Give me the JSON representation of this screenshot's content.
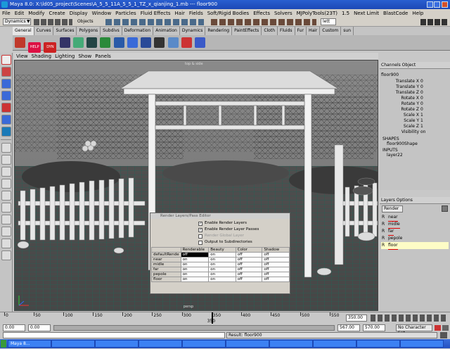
{
  "window": {
    "title": "Maya 8.0: X:\\ld05_project\\Scenes\\A_5_5_11A_5_5_1_TZ_x_qianjing_1.mb  ---  floor900"
  },
  "menubar": [
    "File",
    "Edit",
    "Modify",
    "Create",
    "Display",
    "Window",
    "Particles",
    "Fluid Effects",
    "Hair",
    "Fields",
    "Soft/Rigid Bodies",
    "Effects",
    "Solvers",
    "MJPolyTools(23T)",
    "1.5",
    "Next Limit",
    "BlastCode",
    "Help"
  ],
  "statusline": {
    "mode_dropdown": "Dynamics",
    "objects_label": "Objects",
    "field_value": "lett"
  },
  "shelf_tabs": [
    "General",
    "Curves",
    "Surfaces",
    "Polygons",
    "Subdivs",
    "Deformation",
    "Animation",
    "Dynamics",
    "Rendering",
    "PaintEffects",
    "Cloth",
    "Fluids",
    "Fur",
    "Hair",
    "Custom",
    "sun"
  ],
  "shelf": {
    "help_label": "HELP",
    "dyn_label": "DYN"
  },
  "panel_menu": [
    "View",
    "Shading",
    "Lighting",
    "Show",
    "Panels"
  ],
  "viewport": {
    "camera_label": "persp",
    "top_label": "top & side"
  },
  "render_layers_window": {
    "title": "Render Layers/Pass Editor",
    "checkboxes": [
      {
        "label": "Enable Render Layers",
        "checked": true
      },
      {
        "label": "Enable Render Layer Passes",
        "checked": true
      },
      {
        "label": "Render Global Layer",
        "checked": false
      },
      {
        "label": "Output to Subdirectories",
        "checked": false
      }
    ],
    "columns": [
      "",
      "Renderable",
      "Beauty",
      "Color",
      "Shadow"
    ],
    "rows": [
      {
        "name": "defaultRende",
        "renderable": "off",
        "beauty": "on",
        "color": "off",
        "shadow": "off"
      },
      {
        "name": "near",
        "renderable": "on",
        "beauty": "on",
        "color": "off",
        "shadow": "off"
      },
      {
        "name": "midle",
        "renderable": "on",
        "beauty": "on",
        "color": "off",
        "shadow": "off"
      },
      {
        "name": "far",
        "renderable": "on",
        "beauty": "on",
        "color": "off",
        "shadow": "off"
      },
      {
        "name": "pepole",
        "renderable": "on",
        "beauty": "on",
        "color": "off",
        "shadow": "off"
      },
      {
        "name": "floor",
        "renderable": "on",
        "beauty": "on",
        "color": "off",
        "shadow": "off"
      }
    ]
  },
  "channel_box": {
    "header": "Channels  Object",
    "object_name": "floor900",
    "attributes": [
      {
        "name": "Translate X",
        "value": "0"
      },
      {
        "name": "Translate Y",
        "value": "0"
      },
      {
        "name": "Translate Z",
        "value": "0"
      },
      {
        "name": "Rotate X",
        "value": "0"
      },
      {
        "name": "Rotate Y",
        "value": "0"
      },
      {
        "name": "Rotate Z",
        "value": "0"
      },
      {
        "name": "Scale X",
        "value": "1"
      },
      {
        "name": "Scale Y",
        "value": "1"
      },
      {
        "name": "Scale Z",
        "value": "1"
      },
      {
        "name": "Visibility",
        "value": "on"
      }
    ],
    "shapes_label": "SHAPES",
    "shape_name": "floor900Shape",
    "inputs_label": "INPUTS",
    "input_name": "layer22"
  },
  "layers_panel": {
    "header": "Layers  Options",
    "dropdown": "Render",
    "layers": [
      {
        "flag": "R",
        "name": "near",
        "selected": false
      },
      {
        "flag": "R",
        "name": "midle",
        "selected": false
      },
      {
        "flag": "R",
        "name": "far",
        "selected": false
      },
      {
        "flag": "R",
        "name": "pepole",
        "selected": false
      },
      {
        "flag": "R",
        "name": "floor",
        "selected": true
      }
    ]
  },
  "timeline": {
    "ticks": [
      "0",
      "50",
      "100",
      "150",
      "200",
      "250",
      "300",
      "350",
      "400",
      "450",
      "500",
      "550"
    ],
    "current_frame": "350",
    "frame_field": "350.00"
  },
  "range": {
    "start": "0.00",
    "inner_start": "0.00",
    "inner_end": "567.00",
    "end": "570.00",
    "character_set": "No Character Set"
  },
  "command_line": {
    "result": "Result: floor900"
  },
  "taskbar": {
    "items": [
      "Maya 8...",
      "",
      "",
      "",
      "",
      "",
      "",
      "",
      "",
      ""
    ]
  },
  "colors": {
    "ground_grid": "#1fa58c",
    "title_blue": "#2450c0",
    "selection": "#fdfcc6"
  }
}
